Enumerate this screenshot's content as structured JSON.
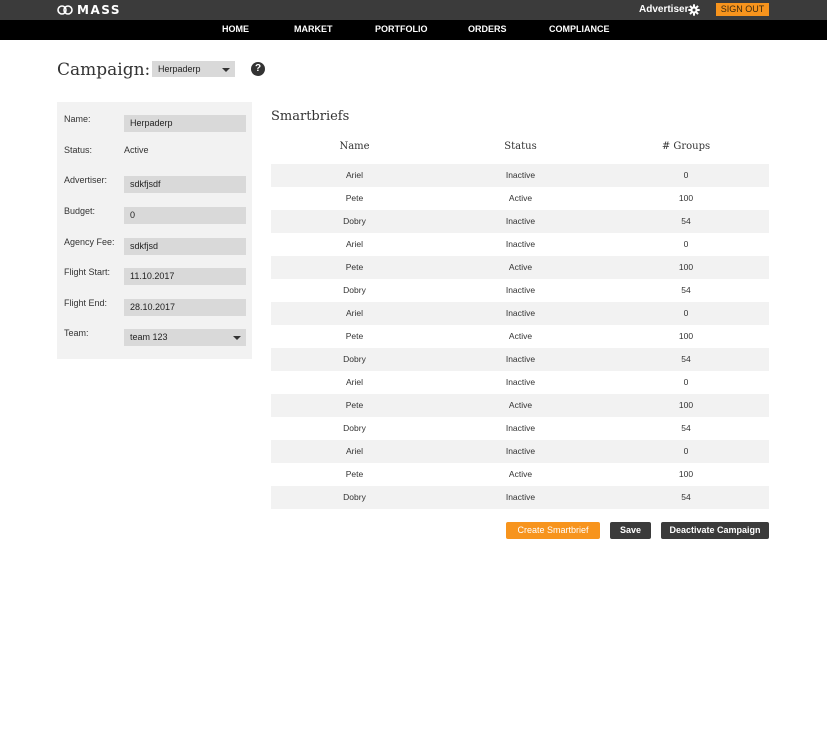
{
  "header": {
    "logo_text": "MASS",
    "user_role": "Advertiser",
    "signout_label": "SIGN OUT"
  },
  "nav": {
    "items": [
      "HOME",
      "MARKET",
      "PORTFOLIO",
      "ORDERS",
      "COMPLIANCE"
    ]
  },
  "campaign": {
    "title_label": "Campaign:",
    "selected": "Herpaderp",
    "help_glyph": "?"
  },
  "form": {
    "name_label": "Name:",
    "name_value": "Herpaderp",
    "status_label": "Status:",
    "status_value": "Active",
    "advertiser_label": "Advertiser:",
    "advertiser_value": "sdkfjsdf",
    "budget_label": "Budget:",
    "budget_value": "0",
    "agency_fee_label": "Agency Fee:",
    "agency_fee_value": "sdkfjsd",
    "flight_start_label": "Flight Start:",
    "flight_start_value": "11.10.2017",
    "flight_end_label": "Flight End:",
    "flight_end_value": "28.10.2017",
    "team_label": "Team:",
    "team_value": "team 123"
  },
  "smartbriefs": {
    "title": "Smartbriefs",
    "columns": [
      "Name",
      "Status",
      "# Groups"
    ],
    "rows": [
      [
        "Ariel",
        "Inactive",
        "0"
      ],
      [
        "Pete",
        "Active",
        "100"
      ],
      [
        "Dobry",
        "Inactive",
        "54"
      ],
      [
        "Ariel",
        "Inactive",
        "0"
      ],
      [
        "Pete",
        "Active",
        "100"
      ],
      [
        "Dobry",
        "Inactive",
        "54"
      ],
      [
        "Ariel",
        "Inactive",
        "0"
      ],
      [
        "Pete",
        "Active",
        "100"
      ],
      [
        "Dobry",
        "Inactive",
        "54"
      ],
      [
        "Ariel",
        "Inactive",
        "0"
      ],
      [
        "Pete",
        "Active",
        "100"
      ],
      [
        "Dobry",
        "Inactive",
        "54"
      ],
      [
        "Ariel",
        "Inactive",
        "0"
      ],
      [
        "Pete",
        "Active",
        "100"
      ],
      [
        "Dobry",
        "Inactive",
        "54"
      ]
    ]
  },
  "actions": {
    "create_label": "Create Smartbrief",
    "save_label": "Save",
    "deactivate_label": "Deactivate Campaign"
  },
  "colors": {
    "accent": "#f7941d",
    "topbar": "#3b3b3b",
    "navbar": "#000000",
    "panel": "#f2f2f2",
    "input": "#d9d9d9"
  }
}
